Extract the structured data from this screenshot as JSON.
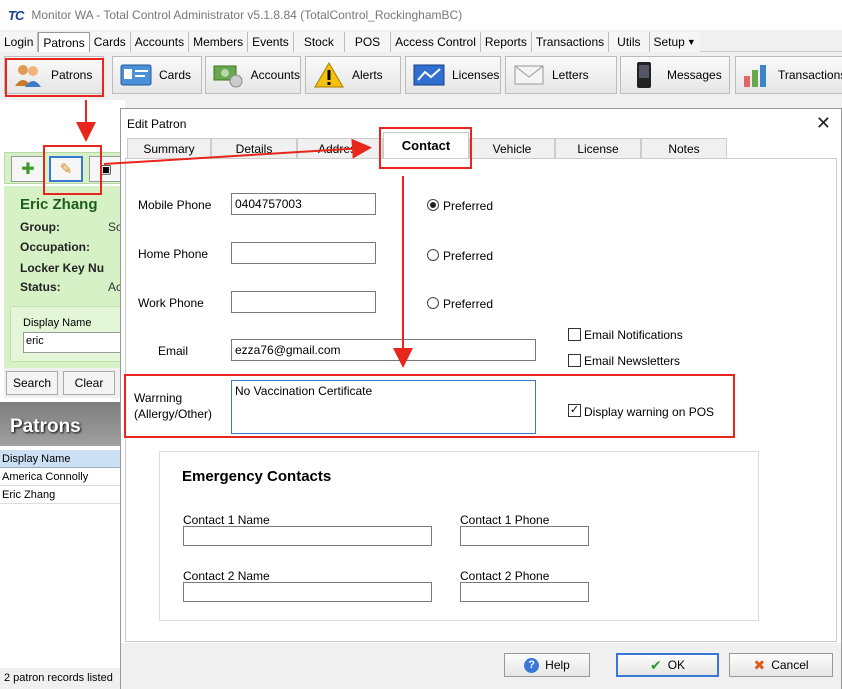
{
  "window": {
    "logo": "TC",
    "title": "Monitor WA - Total Control Administrator v5.1.8.84 (TotalControl_RockinghamBC)"
  },
  "menu": [
    "Login",
    "Patrons",
    "Cards",
    "Accounts",
    "Members",
    "Events",
    "Stock",
    "POS",
    "Access Control",
    "Reports",
    "Transactions",
    "Utils",
    "Setup"
  ],
  "menu_active": "Patrons",
  "toolbar": [
    {
      "label": "Patrons",
      "icon": "people-icon"
    },
    {
      "label": "Cards",
      "icon": "id-card-icon"
    },
    {
      "label": "Accounts",
      "icon": "money-icon"
    },
    {
      "label": "Alerts",
      "icon": "warning-icon"
    },
    {
      "label": "Licenses",
      "icon": "license-icon"
    },
    {
      "label": "Letters",
      "icon": "envelope-icon"
    },
    {
      "label": "Messages",
      "icon": "phone-icon"
    },
    {
      "label": "Transactions",
      "icon": "bar-chart-icon"
    }
  ],
  "patron_panel": {
    "name": "Eric Zhang",
    "fields": [
      {
        "label": "Group:",
        "value": "So"
      },
      {
        "label": "Occupation:",
        "value": ""
      },
      {
        "label": "Locker Key Nu",
        "value": ""
      },
      {
        "label": "Status:",
        "value": "Ac"
      }
    ],
    "display_name_label": "Display Name",
    "display_name_value": "eric",
    "search_label": "Search",
    "clear_label": "Clear",
    "list_title": "Patrons",
    "column_header": "Display Name",
    "rows": [
      "America Connolly",
      "Eric Zhang"
    ],
    "status": "2 patron records listed"
  },
  "dialog": {
    "title": "Edit Patron",
    "close": "✕",
    "tabs": [
      "Summary",
      "Details",
      "Address",
      "Contact",
      "Vehicle",
      "License",
      "Notes"
    ],
    "active_tab": "Contact",
    "mobile_label": "Mobile Phone",
    "mobile_value": "0404757003",
    "home_label": "Home Phone",
    "home_value": "",
    "work_label": "Work Phone",
    "work_value": "",
    "preferred_label": "Preferred",
    "preferred_selected": "mobile",
    "email_label": "Email",
    "email_value": "ezza76@gmail.com",
    "email_notifications_label": "Email Notifications",
    "email_notifications": false,
    "email_newsletters_label": "Email Newsletters",
    "email_newsletters": false,
    "warning_label_1": "Warrning",
    "warning_label_2": "(Allergy/Other)",
    "warning_value": "No Vaccination Certificate",
    "display_warning_label": "Display warning on POS",
    "display_warning": true,
    "emergency_title": "Emergency Contacts",
    "contact1_name_label": "Contact 1 Name",
    "contact1_phone_label": "Contact 1 Phone",
    "contact2_name_label": "Contact 2 Name",
    "contact2_phone_label": "Contact 2 Phone",
    "help_label": "Help",
    "ok_label": "OK",
    "cancel_label": "Cancel"
  },
  "colors": {
    "annotation": "#e8261c",
    "accent": "#3a78d6",
    "patron_panel_bg": "#d7f1c6"
  }
}
